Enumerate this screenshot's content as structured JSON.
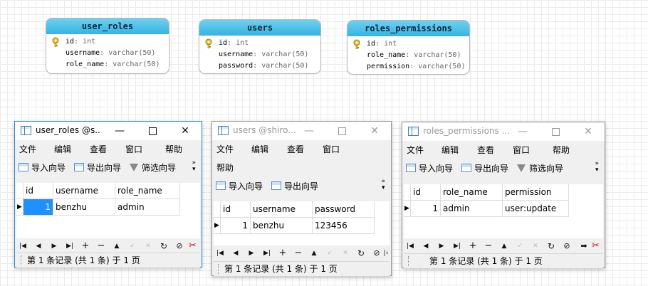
{
  "er_diagram": {
    "entities": [
      {
        "name": "user_roles",
        "fields": [
          {
            "name": "id",
            "type": "int",
            "key": true
          },
          {
            "name": "username",
            "type": "varchar(50)",
            "key": false
          },
          {
            "name": "role_name",
            "type": "varchar(50)",
            "key": false
          }
        ]
      },
      {
        "name": "users",
        "fields": [
          {
            "name": "id",
            "type": "int",
            "key": true
          },
          {
            "name": "username",
            "type": "varchar(50)",
            "key": false
          },
          {
            "name": "password",
            "type": "varchar(50)",
            "key": false
          }
        ]
      },
      {
        "name": "roles_permissions",
        "fields": [
          {
            "name": "id",
            "type": "int",
            "key": true
          },
          {
            "name": "role_name",
            "type": "varchar(50)",
            "key": false
          },
          {
            "name": "permission",
            "type": "varchar(50)",
            "key": false
          }
        ]
      }
    ]
  },
  "common": {
    "menu": [
      "文件",
      "编辑",
      "查看",
      "窗口",
      "帮助"
    ],
    "toolbar": {
      "import": "导入向导",
      "export": "导出向导",
      "filter": "筛选向导",
      "overflow": "»"
    },
    "status_text": "第 1 条记录 (共 1 条) 于 1 页",
    "window_buttons": {
      "minimize": "—",
      "close": "✕"
    },
    "row_indicator": "▶"
  },
  "windows": [
    {
      "title": "user_roles @s...",
      "state": "active",
      "columns": [
        "id",
        "username",
        "role_name"
      ],
      "rows": [
        [
          "1",
          "benzhu",
          "admin"
        ]
      ]
    },
    {
      "title": "users @shiro...",
      "state": "inactive",
      "columns": [
        "id",
        "username",
        "password"
      ],
      "rows": [
        [
          "1",
          "benzhu",
          "123456"
        ]
      ]
    },
    {
      "title": "roles_permissions ...",
      "state": "inactive",
      "columns": [
        "id",
        "role_name",
        "permission"
      ],
      "rows": [
        [
          "1",
          "admin",
          "user:update"
        ]
      ]
    }
  ],
  "nav_icons": [
    "first-record-icon",
    "prior-record-icon",
    "next-record-icon",
    "last-record-icon",
    "insert-record-icon",
    "delete-record-icon",
    "edit-up-icon",
    "apply-icon",
    "cancel-icon",
    "refresh-icon",
    "stop-icon",
    "tools-icon"
  ]
}
